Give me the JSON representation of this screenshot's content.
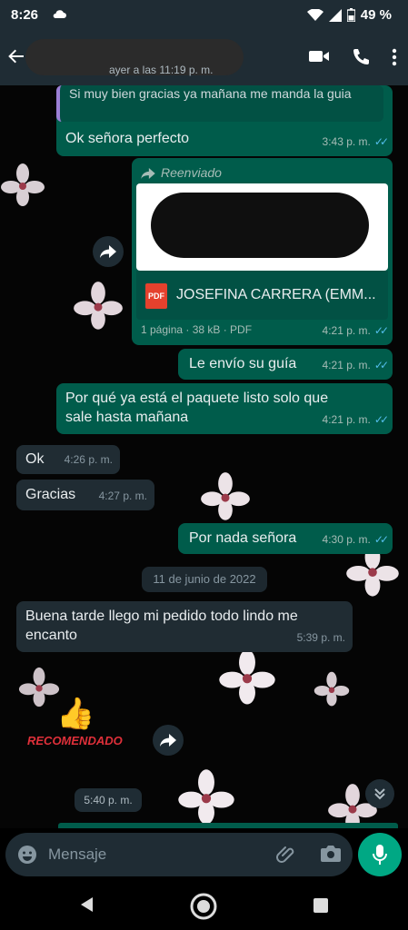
{
  "status_bar": {
    "time": "8:26",
    "battery": "49 %"
  },
  "header": {
    "subtitle": "ayer a las 11:19 p. m."
  },
  "messages": [
    {
      "quoted_text": "Si muy bien gracias ya mañana me manda la guia",
      "text": "Ok señora perfecto",
      "time": "3:43 p. m."
    },
    {
      "forwarded_label": "Reenviado",
      "file_name": "JOSEFINA CARRERA (EMM...",
      "file_type_icon": "PDF",
      "file_meta": "1 página · 38 kB · PDF",
      "time": "4:21 p. m."
    },
    {
      "text": "Le envío su guía",
      "time": "4:21 p. m."
    },
    {
      "text": "Por qué ya está el paquete listo solo que sale hasta mañana",
      "time": "4:21 p. m."
    },
    {
      "text": "Ok",
      "time": "4:26 p. m."
    },
    {
      "text": "Gracias",
      "time": "4:27 p. m."
    },
    {
      "text": "Por nada señora",
      "time": "4:30 p. m."
    },
    {
      "date_separator": "11 de junio de 2022"
    },
    {
      "text": "Buena tarde llego mi pedido todo lindo me encanto",
      "time": "5:39 p. m."
    },
    {
      "sticker_text": "Recomendado",
      "time": "5:40 p. m."
    }
  ],
  "composer": {
    "placeholder": "Mensaje"
  },
  "colors": {
    "header": "#1f2c34",
    "outgoing": "#005c4b",
    "incoming": "#202c33",
    "accent": "#00a884",
    "read_ticks": "#53bdeb"
  }
}
